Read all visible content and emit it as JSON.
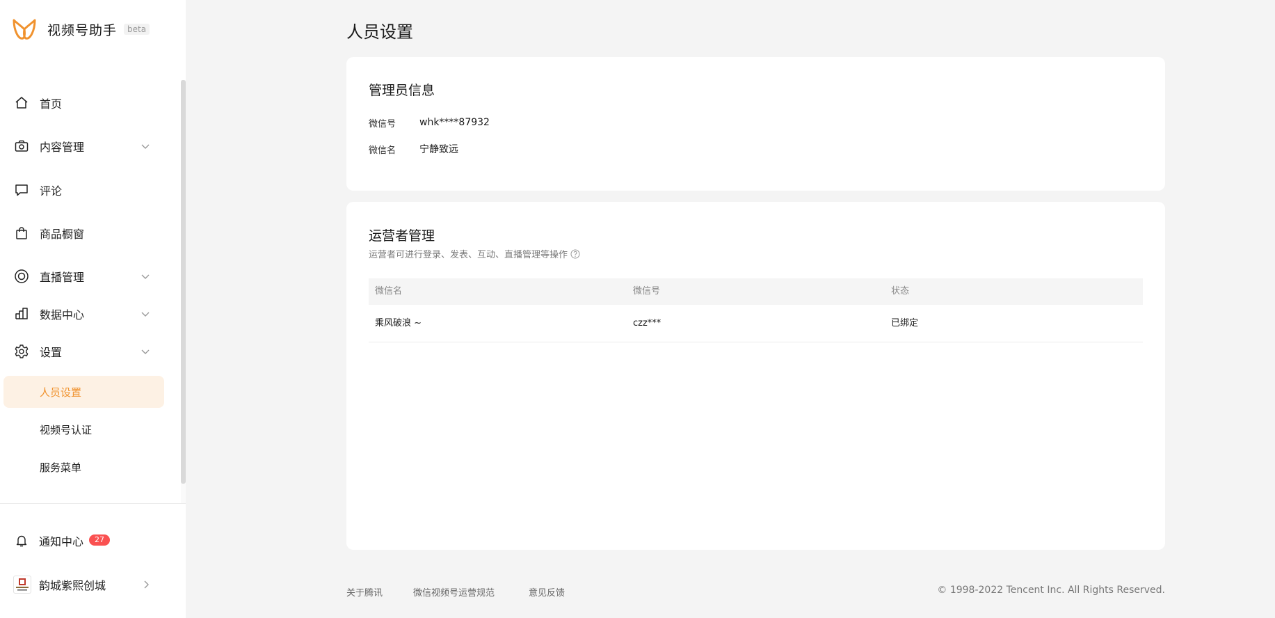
{
  "brand": {
    "name": "视频号助手",
    "beta": "beta",
    "accent_color": "#f0922e"
  },
  "sidebar": {
    "items": [
      {
        "label": "首页",
        "icon": "home-icon",
        "has_chevron": false
      },
      {
        "label": "内容管理",
        "icon": "camera-icon",
        "has_chevron": true
      },
      {
        "label": "评论",
        "icon": "comment-icon",
        "has_chevron": false
      },
      {
        "label": "商品橱窗",
        "icon": "shopping-bag-icon",
        "has_chevron": false
      },
      {
        "label": "直播管理",
        "icon": "live-icon",
        "has_chevron": true
      },
      {
        "label": "数据中心",
        "icon": "bar-chart-icon",
        "has_chevron": true
      },
      {
        "label": "设置",
        "icon": "gear-icon",
        "has_chevron": true,
        "expanded": true
      }
    ],
    "settings_subitems": [
      {
        "label": "人员设置",
        "active": true
      },
      {
        "label": "视频号认证",
        "active": false
      },
      {
        "label": "服务菜单",
        "active": false
      }
    ],
    "notice": {
      "label": "通知中心",
      "icon": "bell-icon",
      "badge": "27"
    },
    "account": {
      "name": "韵城紫熙创城",
      "icon": "chevron-right-icon"
    }
  },
  "main": {
    "title": "人员设置",
    "admin": {
      "title": "管理员信息",
      "wechat_id_label": "微信号",
      "wechat_id_value": "whk****87932",
      "wechat_name_label": "微信名",
      "wechat_name_value": "宁静致远"
    },
    "operator": {
      "title": "运营者管理",
      "desc": "运营者可进行登录、发表、互动、直播管理等操作",
      "columns": [
        "微信名",
        "微信号",
        "状态"
      ],
      "rows": [
        {
          "name": "乘风破浪 ~",
          "wechat_id": "czz***",
          "status": "已绑定"
        }
      ]
    }
  },
  "footer": {
    "links": [
      "关于腾讯",
      "微信视频号运营规范",
      "意见反馈"
    ],
    "copyright": "© 1998-2022 Tencent Inc. All Rights Reserved."
  }
}
